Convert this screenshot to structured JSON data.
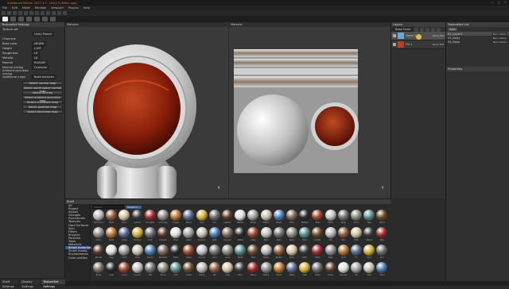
{
  "app": {
    "title": "Substance Painter 2017.1.2 - Unity 5 (Rasm.spp)",
    "winbtns": [
      "—",
      "□",
      "✕"
    ]
  },
  "menu": [
    "File",
    "Edit",
    "Mode",
    "Window",
    "Viewport",
    "Plugins",
    "Help"
  ],
  "left_panel": {
    "title": "TextureSet Settings",
    "rows": [
      {
        "label": "Texture set",
        "value": ""
      },
      {
        "label": "",
        "value": "Unity Planet"
      },
      {
        "label": "Channels",
        "value": ""
      },
      {
        "label": "Base color",
        "value": "sRGB8"
      },
      {
        "label": "Height",
        "value": "L16F"
      },
      {
        "label": "Roughness",
        "value": "L8"
      },
      {
        "label": "Metallic",
        "value": "L8"
      },
      {
        "label": "Normal",
        "value": "RGB16F"
      },
      {
        "label": "Normal mixing",
        "value": "Combine"
      },
      {
        "label": "Ambient occlusion mixing",
        "value": ""
      },
      {
        "label": "Additional maps",
        "value": "Bake textures"
      }
    ],
    "buttons": [
      "Select normal map",
      "Select world space normal map",
      "Select ID map",
      "Select ambient occlusion map",
      "Select curvature map",
      "Select position map",
      "Select thickness map"
    ]
  },
  "viewports": {
    "material_3d": "Material",
    "material_2d": "Material",
    "axis_3d": "y",
    "axis_2d": "y"
  },
  "layers": {
    "title": "Layers",
    "mode": "Base Color",
    "items": [
      {
        "name": "Layer 1",
        "opacity": "Norm 100"
      },
      {
        "name": "Fill 1",
        "opacity": "Norm 100"
      }
    ]
  },
  "textureset_list": {
    "title": "TextureSet List",
    "header_btn": "Solo",
    "items": [
      {
        "name": "02_Layer1",
        "shader": "Main shader"
      },
      {
        "name": "03_Body",
        "shader": "Main shader"
      },
      {
        "name": "04_Base",
        "shader": "Main shader"
      }
    ]
  },
  "properties": {
    "title": "Properties"
  },
  "shelf": {
    "title": "Shelf",
    "search_placeholder": "Search",
    "filter_tag": "Smart m...",
    "categories": [
      "All",
      "Project",
      "Alphas",
      "Grunges",
      "Procedurals",
      "Textures",
      "Hard Surfaces",
      "Skin",
      "Filters",
      "Brushes",
      "Particles",
      "Tools",
      "Materials",
      "Smart materials",
      "Smart masks",
      "Environments",
      "Color profiles"
    ],
    "active_category": "Smart materials",
    "rows": [
      [
        "Aluminium",
        "Base",
        "Bone",
        "Carbon",
        "Car paint",
        "Concrete",
        "Copper",
        "Fabric",
        "Gold",
        "Iron",
        "Leather",
        "Marble",
        "Nickel",
        "Plaster",
        "Plastic",
        "Rock",
        "Rubber",
        "Rust",
        "Silver",
        "Steel",
        "Stone",
        "Tiles",
        "Wood"
      ],
      [
        "Armor",
        "Brick",
        "Cable",
        "Chrome",
        "Dust",
        "Enamel",
        "Fiber",
        "Glass",
        "Granite",
        "Jade",
        "Lacquer",
        "Metal",
        "Moss",
        "Paint",
        "Pearl",
        "Resin",
        "Sand",
        "Scales",
        "Silk",
        "Skin",
        "Titan",
        "Velvet",
        "Wax"
      ],
      [
        "Bronze",
        "Clay",
        "Cloth",
        "Cork",
        "Denim",
        "Emerald",
        "Foam",
        "Glaze",
        "Gravel",
        "Ivory",
        "Lava",
        "Mesh",
        "Mud",
        "Paper",
        "Pewter",
        "Ruby",
        "Satin",
        "Shell",
        "Slate",
        "Soot",
        "Tin",
        "Vinyl",
        "Zinc"
      ],
      [
        "Brass",
        "Coal",
        "Coral",
        "Crystal",
        "Dirt",
        "Ebony",
        "Felt",
        "Grass",
        "Grime",
        "Jet",
        "Leaf",
        "Mica",
        "Nacre",
        "Patina",
        "Plank",
        "Rope",
        "Salt",
        "Shale",
        "Snow",
        "Sponge",
        "Tar",
        "Wire",
        "Wool"
      ]
    ]
  },
  "bottom_tabs": [
    "Shelf Settings",
    "Display Settings",
    "TextureSet Settings"
  ],
  "active_bottom_tab": "TextureSet Settings"
}
